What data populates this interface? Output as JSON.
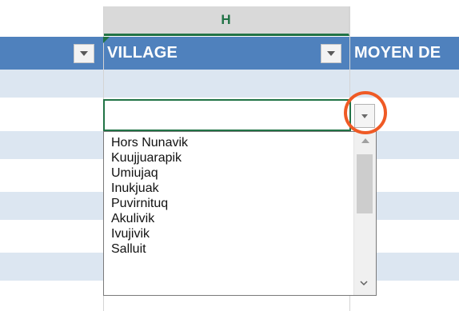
{
  "sheet": {
    "column_header": "H"
  },
  "table": {
    "headers": {
      "village": "VILLAGE",
      "moyen": "MOYEN DE"
    }
  },
  "dropdown": {
    "items": [
      "Hors Nunavik",
      "Kuujjuarapik",
      "Umiujaq",
      "Inukjuak",
      "Puvirnituq",
      "Akulivik",
      "Ivujivik",
      "Salluit"
    ]
  },
  "colors": {
    "header_blue": "#4f81bd",
    "band_blue": "#dce6f1",
    "excel_green": "#217346",
    "highlight_orange": "#ef5a25"
  },
  "icons": {
    "filter": "chevron-down-icon",
    "validation": "dropdown-arrow-icon",
    "scroll_up": "chevron-up-icon",
    "scroll_down": "chevron-down-icon"
  }
}
